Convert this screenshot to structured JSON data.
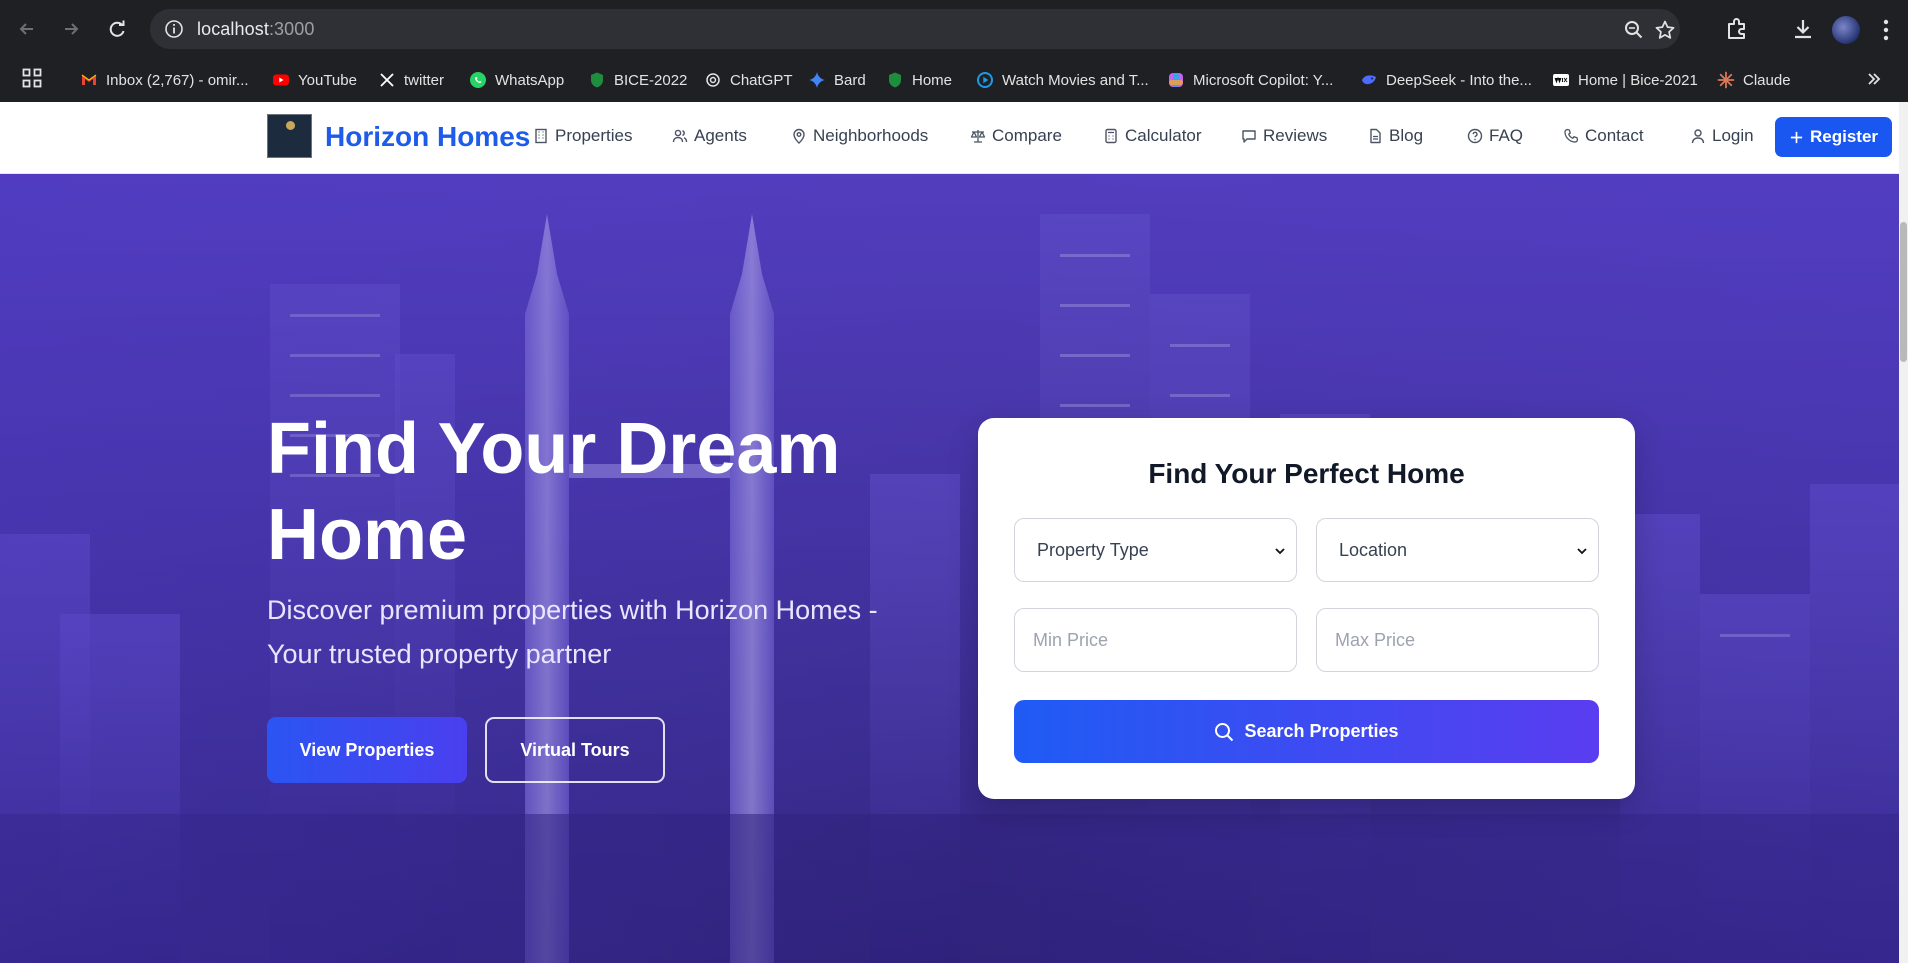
{
  "browser": {
    "url_host": "localhost",
    "url_port": ":3000",
    "bookmarks": [
      {
        "label": "Inbox (2,767) - omir...",
        "icon": "gmail-icon",
        "color": "#ea4335"
      },
      {
        "label": "YouTube",
        "icon": "youtube-icon",
        "color": "#ff0000"
      },
      {
        "label": "twitter",
        "icon": "x-icon",
        "color": "#ffffff"
      },
      {
        "label": "WhatsApp",
        "icon": "whatsapp-icon",
        "color": "#25d366"
      },
      {
        "label": "BICE-2022",
        "icon": "bice-icon",
        "color": "#1e8e3e"
      },
      {
        "label": "ChatGPT",
        "icon": "chatgpt-icon",
        "color": "#e3e3e3"
      },
      {
        "label": "Bard",
        "icon": "bard-icon",
        "color": "#4285f4"
      },
      {
        "label": "Home",
        "icon": "home-site-icon",
        "color": "#1e8e3e"
      },
      {
        "label": "Watch Movies and T...",
        "icon": "play-icon",
        "color": "#1a9be8"
      },
      {
        "label": "Microsoft Copilot: Y...",
        "icon": "copilot-icon",
        "color": "#c065f0"
      },
      {
        "label": "DeepSeek - Into the...",
        "icon": "deepseek-icon",
        "color": "#4d6bfe"
      },
      {
        "label": "Home | Bice-2021",
        "icon": "wix-icon",
        "color": "#ffffff"
      },
      {
        "label": "Claude",
        "icon": "claude-icon",
        "color": "#d97757"
      }
    ]
  },
  "site": {
    "brand": "Horizon Homes",
    "brand_color": "#1d5be8",
    "nav": [
      {
        "label": "Properties",
        "icon": "building-icon"
      },
      {
        "label": "Agents",
        "icon": "users-icon"
      },
      {
        "label": "Neighborhoods",
        "icon": "map-pin-icon"
      },
      {
        "label": "Compare",
        "icon": "scale-icon"
      },
      {
        "label": "Calculator",
        "icon": "calculator-icon"
      },
      {
        "label": "Reviews",
        "icon": "message-icon"
      },
      {
        "label": "Blog",
        "icon": "file-icon"
      },
      {
        "label": "FAQ",
        "icon": "help-circle-icon"
      },
      {
        "label": "Contact",
        "icon": "phone-icon"
      },
      {
        "label": "Login",
        "icon": "user-icon"
      }
    ],
    "register_label": "Register",
    "register_color": "#1a56f0"
  },
  "hero": {
    "title": "Find Your Dream Home",
    "subtitle": "Discover premium properties with Horizon Homes - Your trusted property partner",
    "primary_button": "View Properties",
    "secondary_button": "Virtual Tours"
  },
  "search_card": {
    "title": "Find Your Perfect Home",
    "property_type": "Property Type",
    "location": "Location",
    "min_price_placeholder": "Min Price",
    "max_price_placeholder": "Max Price",
    "search_button": "Search Properties"
  }
}
